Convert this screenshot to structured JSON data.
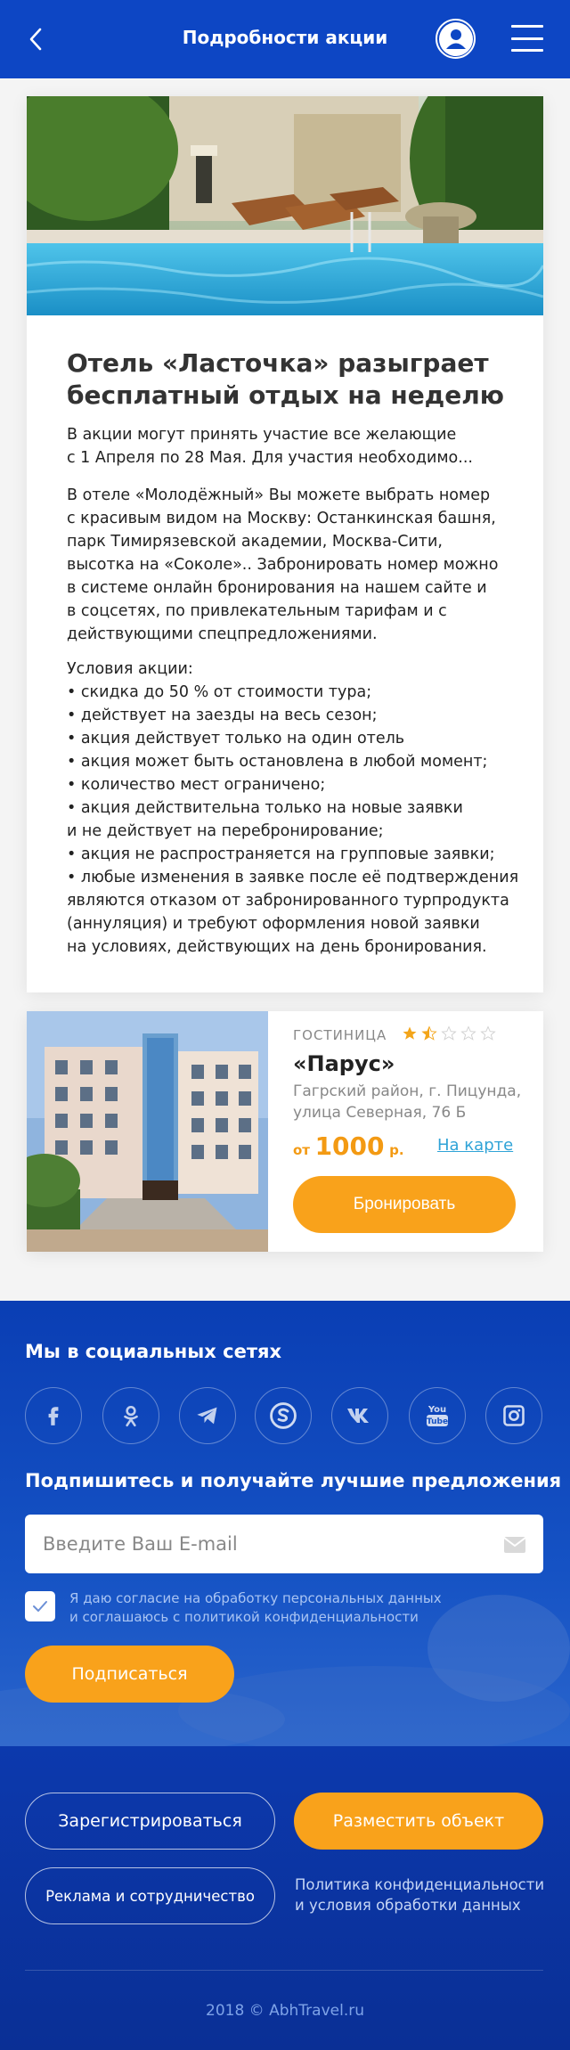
{
  "header": {
    "title": "Подробности акции"
  },
  "promo": {
    "title_line1": "Отель «Ласточка» разыграет",
    "title_line2": "бесплатный отдых на неделю",
    "lead": [
      "В акции могут принять участие все желающие",
      "с 1 Апреля по 28 Мая. Для участия необходимо..."
    ],
    "para": [
      "В отеле «Молодёжный» Вы можете выбрать номер",
      "с красивым видом на Москву: Останкинская башня,",
      "парк Тимирязевской академии, Москва-Сити,",
      "высотка на «Соколе».. Забронировать номер можно",
      "в системе онлайн бронирования на нашем сайте и",
      "в соцсетях, по привлекательным тарифам и с",
      "действующими спецпредложениями."
    ],
    "conditions": [
      "Условия акции:",
      "• скидка до 50 % от стоимости тура;",
      "• действует на заезды на весь сезон;",
      "• акция действует только на один отель",
      "• акция может быть остановлена в любой момент;",
      "• количество мест ограничено;",
      "• акция действительна только на новые заявки",
      "и не действует на перебронирование;",
      "• акция не распространяется на групповые заявки;",
      "• любые изменения в заявке после её подтверждения",
      "являются отказом от забронированного турпродукта",
      "(аннуляция) и требуют оформления новой заявки",
      "на условиях, действующих на день бронирования."
    ]
  },
  "hotel": {
    "type": "ГОСТИНИЦА",
    "rating": 1.5,
    "rating_max": 5,
    "name": "«Парус»",
    "address_line1": "Гагрский район, г. Пицунда,",
    "address_line2": "улица Северная, 76 Б",
    "price_from": "от",
    "price": "1000",
    "currency": "р.",
    "map_link": "На карте",
    "book_label": "Бронировать"
  },
  "footer": {
    "social_heading": "Мы в социальных сетях",
    "social_icons": [
      "facebook-icon",
      "odnoklassniki-icon",
      "telegram-icon",
      "skype-icon",
      "vk-icon",
      "youtube-icon",
      "instagram-icon"
    ],
    "subscribe_heading": "Подпишитесь и получайте лучшие предложения",
    "email_placeholder": "Введите Ваш E-mail",
    "consent_line1": "Я даю согласие на обработку персональных данных",
    "consent_line2": "и соглашаюсь с политикой конфиденциальности",
    "subscribe_label": "Подписаться",
    "register_label": "Зарегистрироваться",
    "place_label": "Разместить объект",
    "ads_label": "Реклама и сотрудничество",
    "policy_line1": "Политика конфиденциальности",
    "policy_line2": "и условия обработки данных",
    "copyright": "2018 © AbhTravel.ru"
  },
  "colors": {
    "brand_blue": "#0d46c4",
    "accent_orange": "#f9a21b",
    "link_blue": "#2fa3d7",
    "star_gold": "#f3a51a"
  }
}
